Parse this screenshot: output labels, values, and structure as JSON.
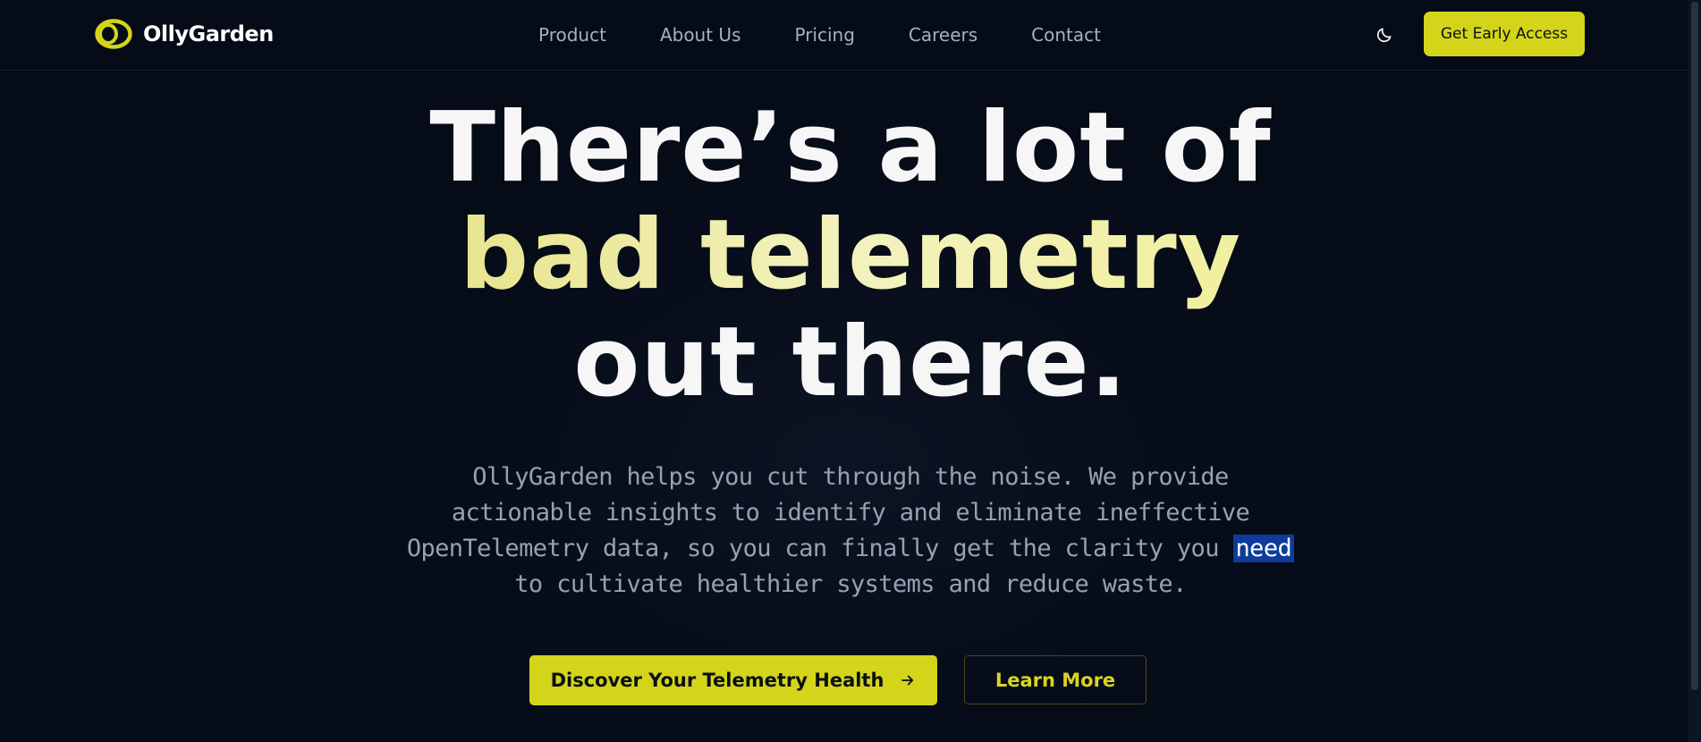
{
  "brand": {
    "name": "OllyGarden",
    "accent_color": "#d4d41a",
    "background_color": "#050b17"
  },
  "nav": {
    "items": [
      {
        "label": "Product"
      },
      {
        "label": "About Us"
      },
      {
        "label": "Pricing"
      },
      {
        "label": "Careers"
      },
      {
        "label": "Contact"
      }
    ],
    "theme_toggle_icon": "moon-icon",
    "cta_label": "Get Early Access"
  },
  "hero": {
    "title_line1": "There’s a lot of",
    "title_highlight": "bad telemetry",
    "title_line3": "out there.",
    "subtitle_before": "OllyGarden helps you cut through the noise. We provide actionable insights to identify and eliminate ineffective OpenTelemetry data, so you can finally get the clarity you ",
    "subtitle_selected": "need",
    "subtitle_after": " to cultivate healthier systems and reduce waste.",
    "primary_button_label": "Discover Your Telemetry Health",
    "primary_button_icon": "arrow-right-icon",
    "secondary_button_label": "Learn More"
  }
}
